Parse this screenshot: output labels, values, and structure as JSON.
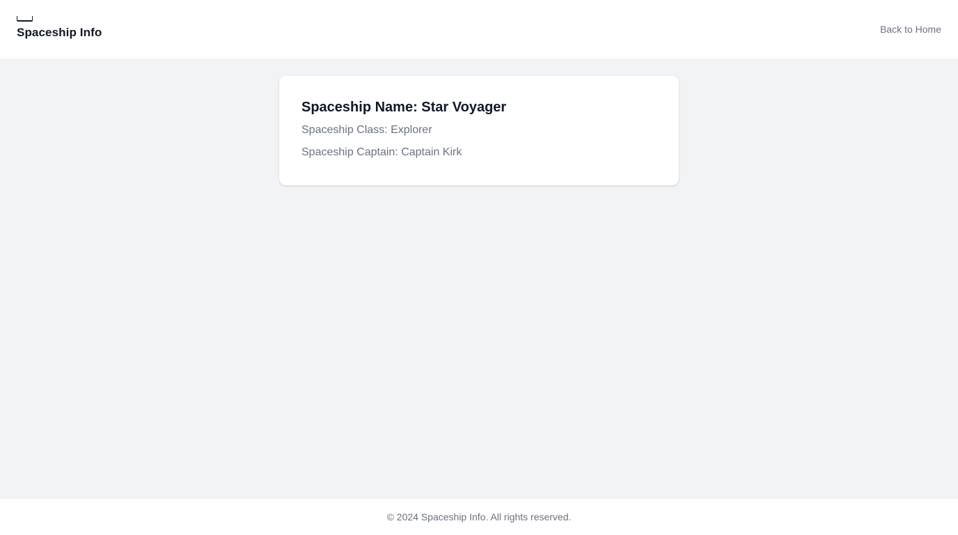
{
  "header": {
    "brand_icon": "spaceship-logo-icon",
    "title": "Spaceship Info",
    "nav_link": "Back to Home"
  },
  "spaceship": {
    "name_line": "Spaceship Name: Star Voyager",
    "class_line": "Spaceship Class: Explorer",
    "captain_line": "Spaceship Captain: Captain Kirk"
  },
  "footer": {
    "copyright": "© 2024 Spaceship Info. All rights reserved."
  },
  "colors": {
    "background": "#f2f3f5",
    "surface": "#ffffff",
    "text_primary": "#111827",
    "text_muted": "#6b7280"
  }
}
